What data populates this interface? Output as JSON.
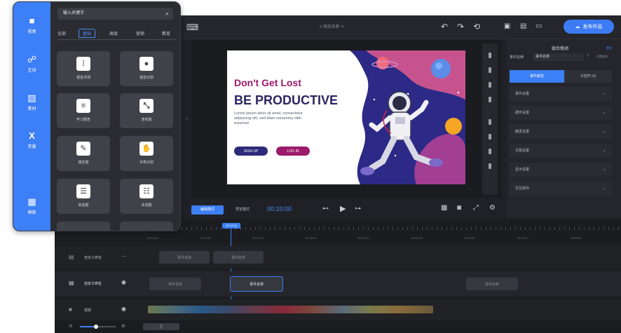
{
  "editor": {
    "project_name": "项目名称",
    "publish_label": "发布作品",
    "slide": {
      "title_line1": "Don't Get Lost",
      "title_line2": "BE PRODUCTIVE",
      "body_text": "Lorem ipsum dolor sit amet, consectetur adipiscing elit, sed diam nonummy nibh euismod",
      "signup_label": "SIGN UP",
      "login_label": "LOG IN"
    },
    "controls": {
      "edit_mode_label": "编辑模式",
      "preview_mode_label": "预览模式",
      "time": "00:10:00"
    },
    "right_panel": {
      "title": "组合拖动",
      "link_label": "更多",
      "event_name_label": "事件名称:",
      "event_name_value": "事件名称",
      "event_hint": "设置规则",
      "tab_attributes": "事件属性",
      "tab_subcomponents": "子控件 (4)",
      "sections": [
        "事件设置",
        "循环设置",
        "触发设置",
        "主题设置",
        "显示设置",
        "交互操作"
      ]
    },
    "timeline": {
      "playhead_time": "00:10:00",
      "ruler_labels": [
        "00:00:00",
        "00:10:00",
        "00:20:00",
        "00:30:00",
        "00:40:00",
        "00:50:00",
        "00:60:00",
        "00:70:00",
        "00:80:00"
      ],
      "tracks": [
        {
          "label": "自定义命名",
          "blocks": [
            "事件名称",
            "事件名称"
          ]
        },
        {
          "label": "自定义命名",
          "blocks": [
            "事件名称",
            "事件名称",
            "事件名称"
          ]
        },
        {
          "label": "视频",
          "blocks": []
        }
      ]
    }
  },
  "sidepanel": {
    "nav": [
      {
        "label": "视频",
        "icon": "video-icon"
      },
      {
        "label": "互动",
        "icon": "interaction-icon"
      },
      {
        "label": "素材",
        "icon": "image-icon"
      },
      {
        "label": "变量",
        "icon": "variable-icon"
      },
      {
        "label": "模版",
        "icon": "template-icon"
      }
    ],
    "search_placeholder": "输入关键字",
    "tabs": [
      "全部",
      "基础",
      "高级",
      "营销",
      "教育"
    ],
    "active_tab": "基础",
    "cards": [
      {
        "label": "语音评测",
        "icon": "soundwave-icon"
      },
      {
        "label": "语音识别",
        "icon": "microphone-icon"
      },
      {
        "label": "学习报告",
        "icon": "report-icon"
      },
      {
        "label": "连线题",
        "icon": "connect-icon"
      },
      {
        "label": "填空题",
        "icon": "edit-icon"
      },
      {
        "label": "手势识别",
        "icon": "hand-icon"
      },
      {
        "label": "单选题",
        "icon": "single-choice-icon"
      },
      {
        "label": "多选题",
        "icon": "multi-choice-icon"
      }
    ]
  },
  "colors": {
    "accent": "#3c7ff6",
    "slide_title": "#9c1a6b",
    "slide_subtitle": "#2a2560",
    "signup_button": "#2d2a7a",
    "login_button": "#9c1a6b"
  }
}
